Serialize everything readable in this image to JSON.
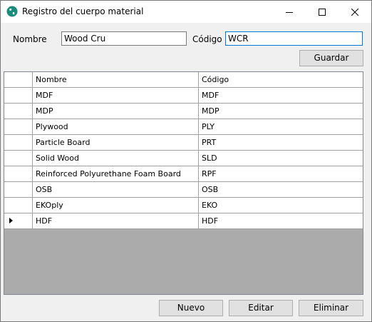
{
  "window": {
    "title": "Registro del cuerpo material",
    "icons": {
      "app": "globe-app-icon",
      "minimize": "minimize-icon",
      "maximize": "maximize-icon",
      "close": "close-icon"
    }
  },
  "form": {
    "nombre_label": "Nombre",
    "nombre_value": "Wood Cru",
    "codigo_label": "Código",
    "codigo_value": "WCR",
    "guardar_label": "Guardar"
  },
  "grid": {
    "columns": [
      "Nombre",
      "Código"
    ],
    "rows": [
      {
        "nombre": "MDF",
        "codigo": "MDF"
      },
      {
        "nombre": "MDP",
        "codigo": "MDP"
      },
      {
        "nombre": "Plywood",
        "codigo": "PLY"
      },
      {
        "nombre": "Particle Board",
        "codigo": "PRT"
      },
      {
        "nombre": "Solid Wood",
        "codigo": "SLD"
      },
      {
        "nombre": "Reinforced Polyurethane Foam Board",
        "codigo": "RPF"
      },
      {
        "nombre": "OSB",
        "codigo": "OSB"
      },
      {
        "nombre": "EKOply",
        "codigo": "EKO"
      },
      {
        "nombre": "HDF",
        "codigo": "HDF"
      }
    ],
    "current_row": 8
  },
  "actions": {
    "nuevo_label": "Nuevo",
    "editar_label": "Editar",
    "eliminar_label": "Eliminar"
  },
  "colors": {
    "accent_focus": "#0078d7",
    "window_bg": "#f0f0f0",
    "grid_empty_bg": "#ababab",
    "button_bg": "#e1e1e1"
  }
}
